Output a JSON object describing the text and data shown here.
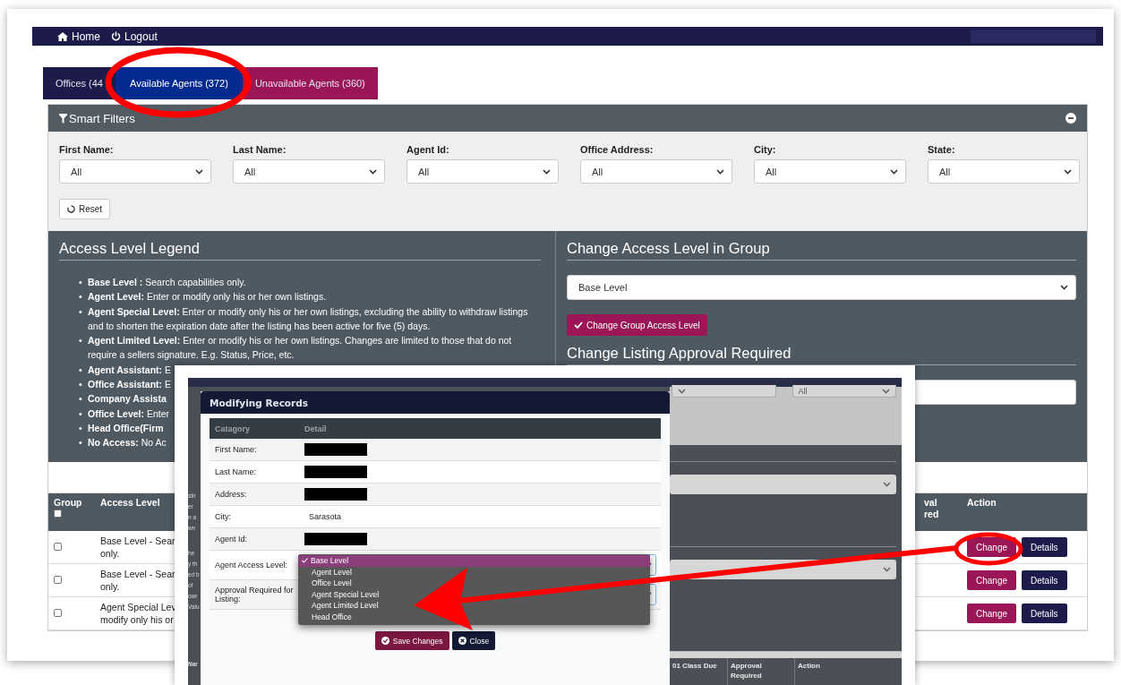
{
  "nav": {
    "items": [
      {
        "label": "Home"
      },
      {
        "label": "Logout"
      }
    ]
  },
  "tabs": [
    {
      "label": "Offices (44",
      "selected": false,
      "color": "#1c1b4b"
    },
    {
      "label": "Available Agents (372)",
      "selected": true,
      "color": "#032a8f"
    },
    {
      "label": "Unavailable Agents (360)",
      "selected": false,
      "color": "#9a1656"
    }
  ],
  "smart_filters": {
    "title": "Smart Filters",
    "expanded": true,
    "filters": [
      {
        "label": "First Name:",
        "value": "All"
      },
      {
        "label": "Last Name:",
        "value": "All"
      },
      {
        "label": "Agent Id:",
        "value": "All"
      },
      {
        "label": "Office Address:",
        "value": "All"
      },
      {
        "label": "City:",
        "value": "All"
      },
      {
        "label": "State:",
        "value": "All"
      }
    ],
    "reset": "Reset"
  },
  "legend": {
    "title": "Access Level Legend",
    "bullet": "•",
    "items": [
      "**Base Level :** Search capabilities only.",
      "**Agent Level:** Enter or modify only his or her own listings.",
      "**Agent Special Level:** Enter or modify only his or her own listings, excluding the ability to withdraw listings and to shorten the expiration date after the listing has been active for five (5) days.",
      "**Agent Limited Level:** Enter or modify his or her own listings. Changes are limited to those that do not require a sellers signature. E.g. Status, Price, etc.",
      "**Agent Assistant:** E",
      "**Office Assistant:** E",
      "**Company Assista**",
      "**Office Level:** Enter",
      "**Head Office(Firm**",
      "**No Access:** No Ac"
    ]
  },
  "group_change": {
    "title": "Change Access Level in Group",
    "value": "Base Level",
    "button": "Change Group Access Level"
  },
  "approval_change": {
    "title": "Change Listing Approval Required"
  },
  "table": {
    "columns": [
      "Group",
      "Access Level",
      "val red",
      "Action"
    ],
    "group_checked": false,
    "rows": [
      {
        "checked": false,
        "access_level": [
          "Base Level - Sear",
          "only."
        ],
        "change": "Change",
        "details": "Details"
      },
      {
        "checked": false,
        "access_level": [
          "Base Level - Sear",
          "only."
        ],
        "change": "Change",
        "details": "Details"
      },
      {
        "checked": false,
        "access_level": [
          "Agent Special Lev",
          "modify only his or"
        ],
        "change": "Change",
        "details": "Details"
      }
    ]
  },
  "overlay": {
    "fragments": [
      "stir",
      "er",
      "n a",
      "wn",
      "he",
      "y th",
      "ed b",
      "of",
      "owr",
      "Valu"
    ],
    "background_select": "All",
    "background_columns": [
      "Nar",
      "01 Class Due",
      "Approval Required",
      "Action"
    ],
    "modal": {
      "title": "Modifying Records",
      "columns": [
        "Catagory",
        "Detail"
      ],
      "rows": [
        {
          "label": "First Name:",
          "kind": "redacted"
        },
        {
          "label": "Last Name:",
          "kind": "redacted"
        },
        {
          "label": "Address:",
          "kind": "redacted"
        },
        {
          "label": "City:",
          "kind": "text",
          "value": "Sarasota"
        },
        {
          "label": "Agent Id:",
          "kind": "redacted"
        },
        {
          "label": "Agent Access Level:",
          "kind": "select"
        },
        {
          "label": "Approval Required for Listing:",
          "kind": "select"
        }
      ],
      "dropdown": [
        {
          "label": "Base Level",
          "selected": true
        },
        {
          "label": "Agent Level",
          "selected": false
        },
        {
          "label": "Office Level",
          "selected": false
        },
        {
          "label": "Agent Special Level",
          "selected": false
        },
        {
          "label": "Agent Limited Level",
          "selected": false
        },
        {
          "label": "Head Office",
          "selected": false
        }
      ],
      "buttons": [
        {
          "label": "Save Changes"
        },
        {
          "label": "Close"
        }
      ]
    }
  }
}
